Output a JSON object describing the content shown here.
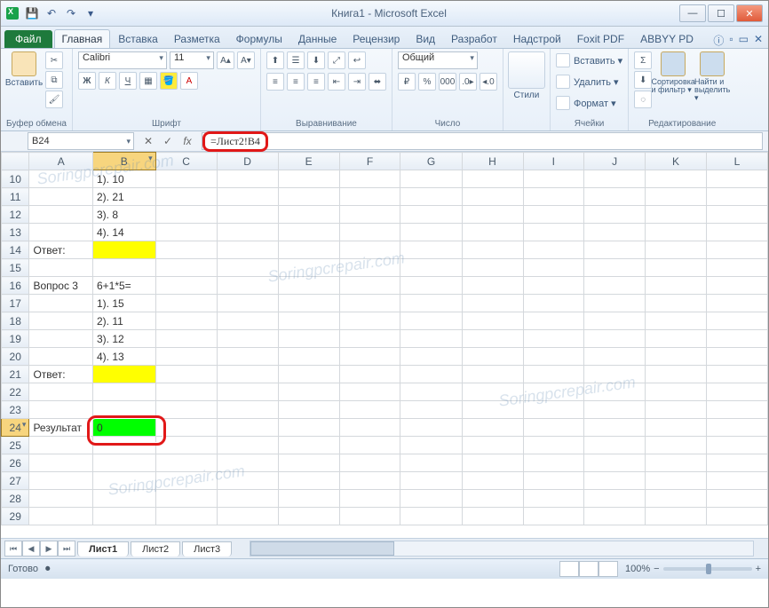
{
  "title": "Книга1  -  Microsoft Excel",
  "tabs": {
    "file": "Файл",
    "list": [
      "Главная",
      "Вставка",
      "Разметка",
      "Формулы",
      "Данные",
      "Рецензир",
      "Вид",
      "Разработ",
      "Надстрой",
      "Foxit PDF",
      "ABBYY PD"
    ],
    "active": "Главная"
  },
  "ribbon": {
    "clipboard": {
      "paste": "Вставить",
      "label": "Буфер обмена"
    },
    "font": {
      "name": "Calibri",
      "size": "11",
      "label": "Шрифт"
    },
    "alignment": {
      "label": "Выравнивание"
    },
    "number": {
      "format": "Общий",
      "label": "Число"
    },
    "styles": {
      "btn": "Стили",
      "label": ""
    },
    "cells": {
      "insert": "Вставить ▾",
      "delete": "Удалить ▾",
      "format": "Формат ▾",
      "label": "Ячейки"
    },
    "editing": {
      "sort": "Сортировка и фильтр ▾",
      "find": "Найти и выделить ▾",
      "label": "Редактирование"
    }
  },
  "namebox": "B24",
  "formula": "=Лист2!B4",
  "columns": [
    "A",
    "B",
    "C",
    "D",
    "E",
    "F",
    "G",
    "H",
    "I",
    "J",
    "K",
    "L"
  ],
  "rows": [
    {
      "n": "10",
      "A": "",
      "B": "1). 10"
    },
    {
      "n": "11",
      "A": "",
      "B": "2). 21"
    },
    {
      "n": "12",
      "A": "",
      "B": "3). 8"
    },
    {
      "n": "13",
      "A": "",
      "B": "4). 14"
    },
    {
      "n": "14",
      "A": "Ответ:",
      "B": "",
      "yellowB": true
    },
    {
      "n": "15",
      "A": "",
      "B": ""
    },
    {
      "n": "16",
      "A": "Вопрос 3",
      "B": "6+1*5="
    },
    {
      "n": "17",
      "A": "",
      "B": "1). 15"
    },
    {
      "n": "18",
      "A": "",
      "B": "2). 11"
    },
    {
      "n": "19",
      "A": "",
      "B": "3). 12"
    },
    {
      "n": "20",
      "A": "",
      "B": "4). 13"
    },
    {
      "n": "21",
      "A": "Ответ:",
      "B": "",
      "yellowB": true
    },
    {
      "n": "22",
      "A": "",
      "B": ""
    },
    {
      "n": "23",
      "A": "",
      "B": ""
    },
    {
      "n": "24",
      "A": "Результат",
      "B": "0",
      "greenB": true,
      "selected": true
    },
    {
      "n": "25",
      "A": "",
      "B": ""
    },
    {
      "n": "26",
      "A": "",
      "B": ""
    },
    {
      "n": "27",
      "A": "",
      "B": ""
    },
    {
      "n": "28",
      "A": "",
      "B": ""
    },
    {
      "n": "29",
      "A": "",
      "B": ""
    }
  ],
  "sheet_tabs": [
    "Лист1",
    "Лист2",
    "Лист3"
  ],
  "active_sheet": "Лист1",
  "status": "Готово",
  "zoom": "100%",
  "watermark": "Soringpcrepair.com"
}
